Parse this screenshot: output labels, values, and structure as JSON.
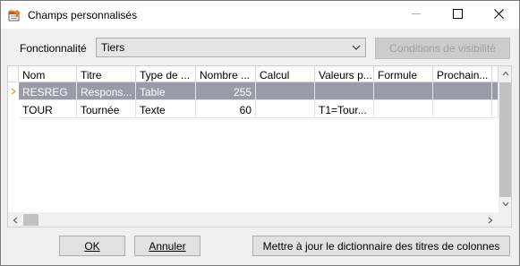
{
  "window": {
    "title": "Champs personnalisés",
    "app_icon": "custom-fields-app-icon",
    "controls": {
      "minimize_icon": "minimize-icon",
      "maximize_icon": "maximize-icon",
      "close_icon": "close-icon"
    }
  },
  "filter": {
    "label": "Fonctionnalité",
    "selected": "Tiers",
    "visibility_button": "Conditions de visibilité"
  },
  "grid": {
    "columns": [
      "Nom",
      "Titre",
      "Type de ...",
      "Nombre ...",
      "Calcul",
      "Valeurs p...",
      "Formule",
      "Prochain..."
    ],
    "rows": [
      {
        "selected": true,
        "cells": [
          "RESREG",
          "Respons...",
          "Table",
          "255",
          "",
          "",
          "",
          ""
        ]
      },
      {
        "selected": false,
        "cells": [
          "TOUR",
          "Tournée",
          "Texte",
          "60",
          "",
          "T1=Tour...",
          "",
          ""
        ]
      }
    ],
    "current_row_indicator": "current-row-arrow-icon"
  },
  "buttons": {
    "ok": "OK",
    "cancel": "Annuler",
    "update_dictionary": "Mettre à jour le dictionnaire des titres de colonnes"
  },
  "colors": {
    "selected_row": "#9a9ba8",
    "indicator_arrow": "#e8a020"
  }
}
